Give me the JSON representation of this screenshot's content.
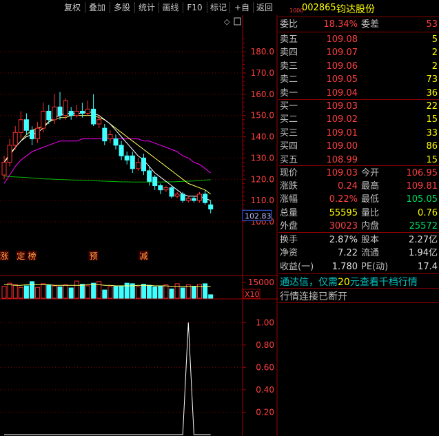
{
  "toolbar": {
    "buttons": [
      "复权",
      "叠加",
      "多股",
      "统计",
      "画线",
      "F10",
      "标记",
      "+自选",
      "返回"
    ]
  },
  "stock": {
    "market_code": "1000",
    "code": "002865",
    "name": "钧达股份"
  },
  "weibi": {
    "label1": "委比",
    "value1": "18.34%",
    "label2": "委差",
    "value2": "53"
  },
  "sell_orders": [
    {
      "label": "卖五",
      "price": "109.08",
      "volume": "5"
    },
    {
      "label": "卖四",
      "price": "109.07",
      "volume": "2"
    },
    {
      "label": "卖三",
      "price": "109.06",
      "volume": "2"
    },
    {
      "label": "卖二",
      "price": "109.05",
      "volume": "73"
    },
    {
      "label": "卖一",
      "price": "109.04",
      "volume": "36"
    }
  ],
  "buy_orders": [
    {
      "label": "买一",
      "price": "109.03",
      "volume": "22"
    },
    {
      "label": "买二",
      "price": "109.02",
      "volume": "15"
    },
    {
      "label": "买三",
      "price": "109.01",
      "volume": "33"
    },
    {
      "label": "买四",
      "price": "109.00",
      "volume": "86"
    },
    {
      "label": "买五",
      "price": "108.99",
      "volume": "15"
    }
  ],
  "quote": [
    {
      "l1": "现价",
      "v1": "109.03",
      "l2": "今开",
      "v2": "106.95",
      "c1": "red",
      "c2": "red"
    },
    {
      "l1": "涨跌",
      "v1": "0.24",
      "l2": "最高",
      "v2": "109.81",
      "c1": "red",
      "c2": "red"
    },
    {
      "l1": "涨幅",
      "v1": "0.22%",
      "l2": "最低",
      "v2": "105.05",
      "c1": "red",
      "c2": "green"
    },
    {
      "l1": "总量",
      "v1": "55595",
      "l2": "量比",
      "v2": "0.76",
      "c1": "yellow",
      "c2": "yellow"
    },
    {
      "l1": "外盘",
      "v1": "30023",
      "l2": "内盘",
      "v2": "25572",
      "c1": "red",
      "c2": "green"
    }
  ],
  "fundamentals": [
    {
      "l1": "换手",
      "v1": "2.87%",
      "l2": "股本",
      "v2": "2.27亿"
    },
    {
      "l1": "净资",
      "v1": "7.22",
      "l2": "流通",
      "v2": "1.94亿"
    },
    {
      "l1": "收益(一)",
      "v1": "1.780",
      "l2": "PE(动)",
      "v2": "17.4"
    }
  ],
  "messages": {
    "promo_prefix": "通达信，仅需",
    "promo_amount": "20",
    "promo_suffix": "元查看千档行情",
    "status": "行情连接已断开"
  },
  "chart_data": [
    {
      "type": "candlestick",
      "name": "price",
      "y_ticks": [
        180,
        170,
        160,
        150,
        140,
        130,
        120,
        110,
        100
      ],
      "y_tick_labels": [
        "180.0",
        "170.0",
        "160.0",
        "150.0",
        "140.0",
        "130.0",
        "120.0",
        "110.0",
        "100.0"
      ],
      "ylim": [
        95,
        190
      ],
      "current_price_label": "102.83",
      "current_price": 102.83,
      "candles": [
        {
          "o": 122,
          "c": 128,
          "h": 131,
          "l": 120
        },
        {
          "o": 128,
          "c": 136,
          "h": 139,
          "l": 126
        },
        {
          "o": 136,
          "c": 142,
          "h": 145,
          "l": 134
        },
        {
          "o": 142,
          "c": 148,
          "h": 152,
          "l": 139
        },
        {
          "o": 148,
          "c": 143,
          "h": 151,
          "l": 141
        },
        {
          "o": 143,
          "c": 139,
          "h": 145,
          "l": 136
        },
        {
          "o": 139,
          "c": 144,
          "h": 147,
          "l": 137
        },
        {
          "o": 144,
          "c": 152,
          "h": 156,
          "l": 142
        },
        {
          "o": 152,
          "c": 148,
          "h": 155,
          "l": 146
        },
        {
          "o": 148,
          "c": 154,
          "h": 160,
          "l": 146
        },
        {
          "o": 154,
          "c": 150,
          "h": 161,
          "l": 148
        },
        {
          "o": 150,
          "c": 157,
          "h": 158,
          "l": 148
        },
        {
          "o": 152,
          "c": 150,
          "h": 154,
          "l": 148
        },
        {
          "o": 150,
          "c": 152,
          "h": 155,
          "l": 149
        },
        {
          "o": 152,
          "c": 151,
          "h": 156,
          "l": 149
        },
        {
          "o": 151,
          "c": 153,
          "h": 157,
          "l": 150
        },
        {
          "o": 153,
          "c": 146,
          "h": 160,
          "l": 145
        },
        {
          "o": 146,
          "c": 148,
          "h": 150,
          "l": 144
        },
        {
          "o": 144,
          "c": 138,
          "h": 146,
          "l": 136
        },
        {
          "o": 139,
          "c": 141,
          "h": 143,
          "l": 137
        },
        {
          "o": 139,
          "c": 136,
          "h": 141,
          "l": 134
        },
        {
          "o": 136,
          "c": 131,
          "h": 138,
          "l": 129
        },
        {
          "o": 131,
          "c": 129,
          "h": 133,
          "l": 127
        },
        {
          "o": 131,
          "c": 125,
          "h": 133,
          "l": 123
        },
        {
          "o": 125,
          "c": 128,
          "h": 130,
          "l": 124
        },
        {
          "o": 130,
          "c": 124,
          "h": 132,
          "l": 122
        },
        {
          "o": 124,
          "c": 119,
          "h": 126,
          "l": 117
        },
        {
          "o": 121,
          "c": 117,
          "h": 122,
          "l": 115
        },
        {
          "o": 117,
          "c": 115,
          "h": 118,
          "l": 113
        },
        {
          "o": 115,
          "c": 116,
          "h": 117,
          "l": 114
        },
        {
          "o": 116,
          "c": 112,
          "h": 117,
          "l": 111
        },
        {
          "o": 112,
          "c": 113,
          "h": 114,
          "l": 111
        },
        {
          "o": 113,
          "c": 110,
          "h": 114,
          "l": 109
        },
        {
          "o": 110,
          "c": 111,
          "h": 112,
          "l": 109
        },
        {
          "o": 111,
          "c": 110,
          "h": 112,
          "l": 109
        },
        {
          "o": 110,
          "c": 113,
          "h": 114,
          "l": 109
        },
        {
          "o": 113,
          "c": 109,
          "h": 115,
          "l": 108
        },
        {
          "o": 108,
          "c": 106,
          "h": 110,
          "l": 104
        }
      ],
      "ma_fast": [
        128,
        132,
        135,
        138,
        140,
        141,
        142,
        144,
        147,
        149,
        150,
        151,
        151,
        151,
        151,
        152,
        151,
        150,
        148,
        146,
        143,
        140,
        137,
        134,
        131,
        129,
        126,
        123,
        121,
        119,
        117,
        115,
        113,
        112,
        112,
        112,
        111,
        110
      ],
      "ma_slow": [
        128,
        131,
        135,
        138,
        141,
        143,
        144,
        145,
        147,
        148,
        149,
        149,
        150,
        150,
        150,
        150,
        150,
        149,
        148,
        146,
        144,
        142,
        140,
        138,
        136,
        134,
        132,
        130,
        128,
        126,
        124,
        122,
        120,
        118,
        117,
        116,
        115,
        113
      ],
      "ma_long": [
        118,
        122,
        126,
        129,
        131,
        133,
        134,
        135,
        136,
        137,
        138,
        138,
        138,
        138,
        139,
        139,
        139,
        139,
        139,
        139,
        139,
        139,
        139,
        139,
        139,
        138,
        138,
        137,
        136,
        135,
        134,
        133,
        131,
        130,
        128,
        127,
        125,
        123
      ],
      "ma_base": [
        121.5,
        121.3,
        121.1,
        121,
        120.8,
        120.6,
        120.4,
        120.2,
        120.1,
        120,
        119.9,
        119.8,
        119.7,
        119.6,
        119.5,
        119.4,
        119.3,
        119.2,
        119.1,
        119,
        118.9,
        118.8,
        118.8,
        118.7,
        118.7,
        118.7,
        118.7,
        118.7,
        118.7,
        118.8,
        118.8,
        118.9,
        119,
        119.1,
        119.2,
        119.4,
        119.6,
        119.8
      ],
      "event_markers": [
        {
          "index": 0,
          "label": "涨"
        },
        {
          "index": 3,
          "label": "定"
        },
        {
          "index": 5,
          "label": "榜"
        },
        {
          "index": 16,
          "label": "预"
        },
        {
          "index": 25,
          "label": "减"
        }
      ]
    },
    {
      "type": "bar",
      "name": "volume",
      "y_tick_label": "15000",
      "unit_label": "X10",
      "values": [
        16000,
        16600,
        16300,
        15800,
        16100,
        16900,
        15800,
        16500,
        16300,
        16100,
        15900,
        16300,
        15700,
        17000,
        16400,
        16100,
        16600,
        16900,
        15300,
        15900,
        16000,
        16100,
        16600,
        16500,
        15900,
        16400,
        16200,
        15900,
        16000,
        16300,
        15500,
        16500,
        15700,
        16300,
        16000,
        16400,
        16500,
        14400
      ],
      "ma": [
        16300,
        16300,
        16200,
        16200,
        16300,
        16300,
        16300,
        16300,
        16300,
        16200,
        16200,
        16200,
        16200,
        16200,
        16200,
        16300,
        16300,
        16300,
        16200,
        16200,
        16100,
        16100,
        16100,
        16100,
        16200,
        16200,
        16200,
        16100,
        16100,
        16100,
        16000,
        16000,
        16000,
        16000,
        16000,
        16000,
        16000,
        16000
      ],
      "ylim": [
        13600,
        17800
      ]
    },
    {
      "type": "line",
      "name": "indicator",
      "y_ticks": [
        1.0,
        0.8,
        0.6,
        0.4,
        0.2
      ],
      "y_tick_labels": [
        "1.00",
        "0.80",
        "0.60",
        "0.40",
        "0.20"
      ],
      "ylim": [
        0,
        1.1
      ],
      "values": [
        0,
        0,
        0,
        0,
        0,
        0,
        0,
        0,
        0,
        0,
        0,
        0,
        0,
        0,
        0,
        0,
        0,
        0,
        0,
        0,
        0,
        0,
        0,
        0,
        0,
        0,
        0,
        0,
        0,
        0,
        0,
        0,
        0,
        1,
        0,
        0,
        0,
        0
      ]
    }
  ]
}
